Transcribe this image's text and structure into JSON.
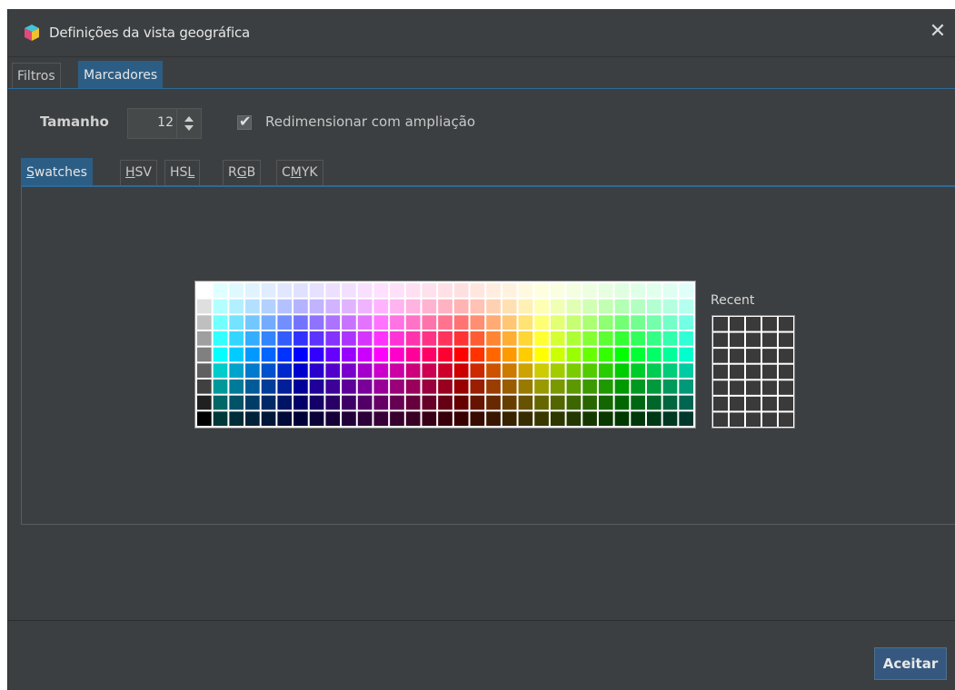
{
  "window": {
    "title": "Definições da vista geográfica",
    "close_glyph": "✕"
  },
  "top_tabs": [
    {
      "label": "Filtros",
      "active": false
    },
    {
      "label": "Marcadores",
      "active": true
    }
  ],
  "marker_settings": {
    "size_label": "Tamanho",
    "size_value": "12",
    "resize_with_zoom_label": "Redimensionar com ampliação",
    "resize_with_zoom_checked": true
  },
  "color_tabs": [
    {
      "label": "Swatches",
      "mnemonic": "S",
      "active": true
    },
    {
      "label": "HSV",
      "mnemonic": "H",
      "active": false
    },
    {
      "label": "HSL",
      "mnemonic": "L",
      "active": false
    },
    {
      "label": "RGB",
      "mnemonic": "G",
      "active": false
    },
    {
      "label": "CMYK",
      "mnemonic": "M",
      "active": false
    }
  ],
  "swatches": {
    "columns": 31,
    "rows": 9
  },
  "recent": {
    "label": "Recent",
    "columns": 5,
    "rows": 7,
    "cell_color": "#3a3a3a"
  },
  "footer": {
    "accept_label": "Aceitar"
  },
  "colors": {
    "window_bg": "#3c3f41",
    "accent": "#2c5e85",
    "button_bg": "#365880"
  }
}
